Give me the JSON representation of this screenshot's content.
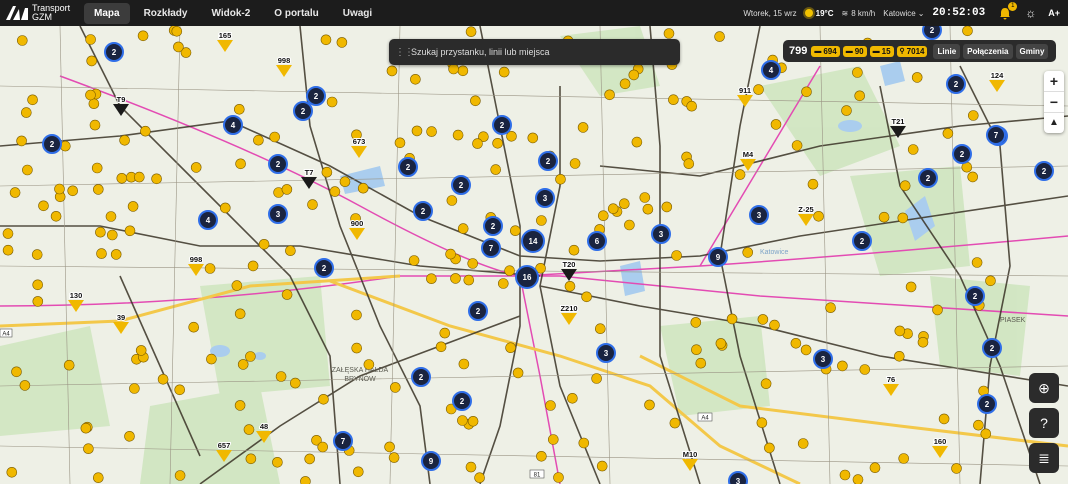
{
  "brand": {
    "line1": "Transport",
    "line2": "GZM"
  },
  "nav": {
    "items": [
      {
        "label": "Mapa",
        "active": true
      },
      {
        "label": "Rozkłady",
        "active": false
      },
      {
        "label": "Widok-2",
        "active": false
      },
      {
        "label": "O portalu",
        "active": false
      },
      {
        "label": "Uwagi",
        "active": false
      }
    ]
  },
  "status": {
    "date": "Wtorek, 15 wrz",
    "temperature": "19°C",
    "wind": "8 km/h",
    "city": "Katowice",
    "clock": "20:52:03",
    "notifications": "1",
    "font_size_label": "A+"
  },
  "search": {
    "placeholder": "Szukaj przystanku, linii lub miejsca"
  },
  "vehicles": {
    "total": "799",
    "bus": "694",
    "tram": "90",
    "trolley": "15",
    "bike": "7014"
  },
  "filters": {
    "lines": "Linie",
    "connections": "Połączenia",
    "communes": "Gminy"
  },
  "zoom": {
    "in": "+",
    "out": "−",
    "north": "▲"
  },
  "map": {
    "place_label_1": "ZAŁĘSKA HAŁDA",
    "place_label_2": "BRYNÓW",
    "district_label": "PIASEK",
    "city_label": "Katowice",
    "road_a4": "A4",
    "road_81": "81",
    "clusters": [
      "2",
      "2",
      "4",
      "2",
      "2",
      "2",
      "2",
      "3",
      "4",
      "2",
      "2",
      "2",
      "2",
      "3",
      "2",
      "7",
      "14",
      "16",
      "6",
      "3",
      "9",
      "3",
      "2",
      "2",
      "2",
      "2",
      "3",
      "2",
      "9",
      "7",
      "2",
      "3",
      "4",
      "7",
      "2",
      "2",
      "3",
      "2",
      "2",
      "2",
      "2",
      "3",
      "2"
    ],
    "line_labels": [
      "165",
      "998",
      "T9",
      "T7",
      "673",
      "900",
      "998",
      "130",
      "39",
      "911",
      "M4",
      "T21",
      "Z-25",
      "T20",
      "Z210",
      "76",
      "48",
      "657",
      "M10",
      "160",
      "124"
    ],
    "colors": {
      "stop": "#f0b800",
      "cluster_ring": "#2f6ee8",
      "cluster_fill": "#1a2440",
      "rail": "#e34bb3",
      "road_major": "#f3c84a"
    }
  }
}
